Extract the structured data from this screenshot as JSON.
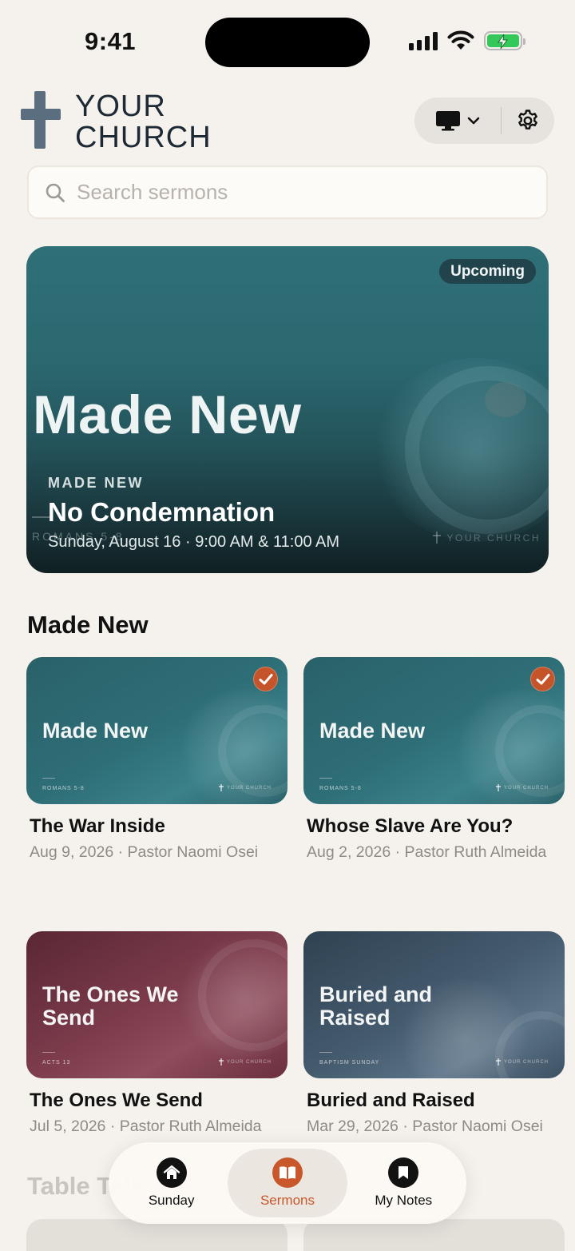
{
  "status_bar": {
    "time": "9:41"
  },
  "header": {
    "logo_line1": "YOUR",
    "logo_line2": "CHURCH",
    "display_icon": "monitor-icon",
    "settings_icon": "gear-icon"
  },
  "search": {
    "placeholder": "Search sermons",
    "value": ""
  },
  "hero": {
    "badge": "Upcoming",
    "big_title": "Made New",
    "series_label": "MADE NEW",
    "title": "No Condemnation",
    "scripture": "ROMANS 5-8",
    "datetime": "Sunday, August 16 · 9:00 AM & 11:00 AM",
    "watermark": "YOUR CHURCH"
  },
  "section": {
    "title": "Made New"
  },
  "sermons": [
    {
      "thumb_title": "Made New",
      "thumb_scripture": "ROMANS 5-8",
      "thumb_watermark": "YOUR CHURCH",
      "title": "The War Inside",
      "meta": "Aug 9, 2026 · Pastor Naomi Osei",
      "watched": true
    },
    {
      "thumb_title": "Made New",
      "thumb_scripture": "ROMANS 5-8",
      "thumb_watermark": "YOUR CHURCH",
      "title": "Whose Slave Are You?",
      "meta": "Aug 2, 2026 · Pastor Ruth Almeida",
      "watched": true
    },
    {
      "thumb_title": "The Ones We Send",
      "thumb_scripture": "ACTS 13",
      "thumb_watermark": "YOUR CHURCH",
      "title": "The Ones We Send",
      "meta": "Jul 5, 2026 · Pastor Ruth Almeida",
      "watched": false
    },
    {
      "thumb_title": "Buried and Raised",
      "thumb_scripture": "BAPTISM SUNDAY",
      "thumb_watermark": "YOUR CHURCH",
      "title": "Buried and Raised",
      "meta": "Mar 29, 2026 · Pastor Naomi Osei",
      "watched": false
    }
  ],
  "next_section": {
    "title": "Table Talk"
  },
  "tabbar": {
    "tabs": [
      {
        "label": "Sunday",
        "icon": "home-icon",
        "active": false
      },
      {
        "label": "Sermons",
        "icon": "book-icon",
        "active": true
      },
      {
        "label": "My Notes",
        "icon": "bookmark-icon",
        "active": false
      }
    ]
  },
  "colors": {
    "accent": "#c8572c",
    "background": "#f5f1ec",
    "battery": "#34c759"
  }
}
